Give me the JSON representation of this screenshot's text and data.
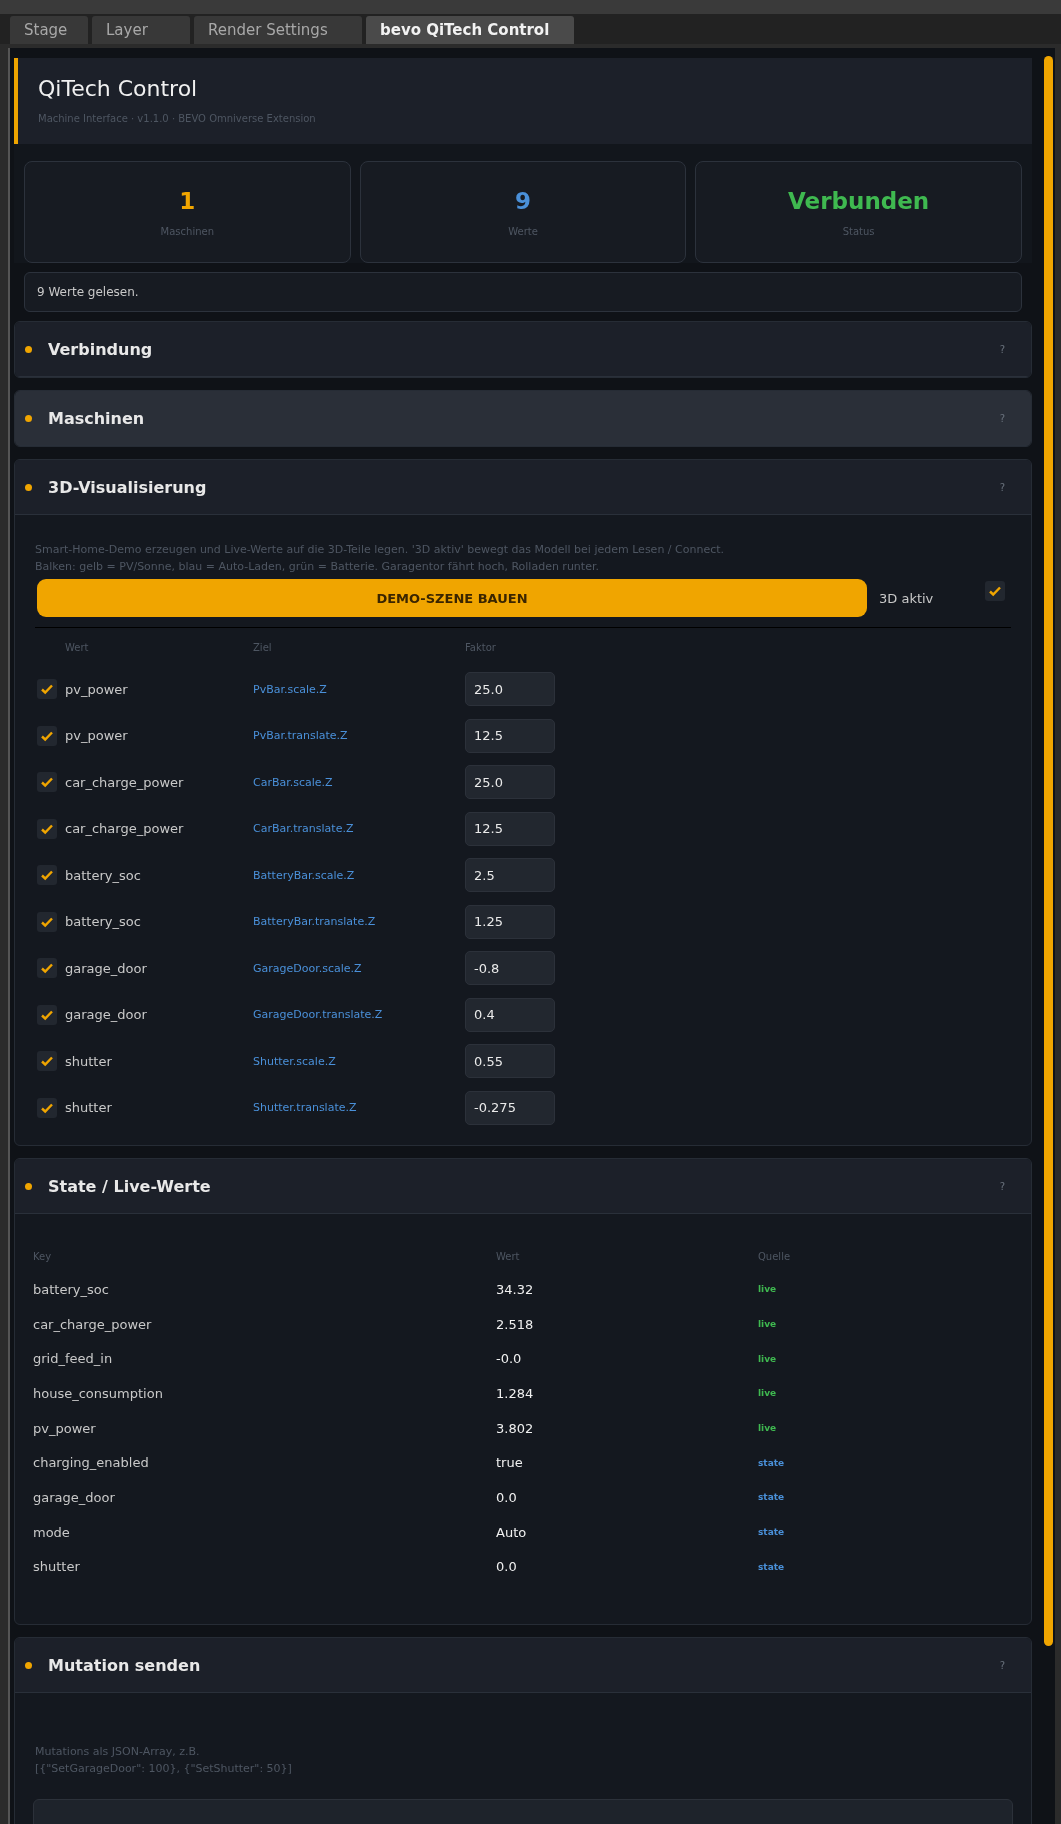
{
  "tabs": [
    {
      "label": "Stage",
      "selected": false
    },
    {
      "label": "Layer",
      "selected": false
    },
    {
      "label": "Render Settings",
      "selected": false
    },
    {
      "label": "bevo QiTech Control",
      "selected": true
    }
  ],
  "header": {
    "title": "QiTech Control",
    "subtitle": "Machine Interface  ·  v1.1.0  ·  BEVO Omniverse Extension"
  },
  "stats": [
    {
      "value": "1",
      "label": "Maschinen",
      "color": "#f0a500"
    },
    {
      "value": "9",
      "label": "Werte",
      "color": "#4a90d9"
    },
    {
      "value": "Verbunden",
      "label": "Status",
      "color": "#3fb950"
    }
  ],
  "status_message": "9 Werte gelesen.",
  "sections": [
    {
      "title": "Verbindung",
      "help": "?",
      "expanded": false,
      "highlighted": false
    },
    {
      "title": "Maschinen",
      "help": "?",
      "expanded": false,
      "highlighted": true
    },
    {
      "kind": "visualization",
      "title": "3D-Visualisierung",
      "help": "?",
      "expanded": true,
      "highlighted": false,
      "description": [
        "Smart-Home-Demo erzeugen und Live-Werte auf die 3D-Teile legen. '3D aktiv' bewegt das Modell bei jedem Lesen / Connect.",
        "Balken: gelb = PV/Sonne, blau = Auto-Laden, grün = Batterie. Garagentor fährt hoch, Rolladen runter."
      ],
      "button": "DEMO-SZENE BAUEN",
      "toggle": {
        "label": "3D aktiv",
        "checked": true
      },
      "columns": [
        "Wert",
        "Ziel",
        "Faktor"
      ],
      "rows": [
        {
          "checked": true,
          "value": "pv_power",
          "target": "PvBar.scale.Z",
          "factor": "25.0"
        },
        {
          "checked": true,
          "value": "pv_power",
          "target": "PvBar.translate.Z",
          "factor": "12.5"
        },
        {
          "checked": true,
          "value": "car_charge_power",
          "target": "CarBar.scale.Z",
          "factor": "25.0"
        },
        {
          "checked": true,
          "value": "car_charge_power",
          "target": "CarBar.translate.Z",
          "factor": "12.5"
        },
        {
          "checked": true,
          "value": "battery_soc",
          "target": "BatteryBar.scale.Z",
          "factor": "2.5"
        },
        {
          "checked": true,
          "value": "battery_soc",
          "target": "BatteryBar.translate.Z",
          "factor": "1.25"
        },
        {
          "checked": true,
          "value": "garage_door",
          "target": "GarageDoor.scale.Z",
          "factor": "-0.8"
        },
        {
          "checked": true,
          "value": "garage_door",
          "target": "GarageDoor.translate.Z",
          "factor": "0.4"
        },
        {
          "checked": true,
          "value": "shutter",
          "target": "Shutter.scale.Z",
          "factor": "0.55"
        },
        {
          "checked": true,
          "value": "shutter",
          "target": "Shutter.translate.Z",
          "factor": "-0.275"
        }
      ]
    },
    {
      "kind": "state",
      "title": "State / Live-Werte",
      "help": "?",
      "expanded": true,
      "highlighted": false,
      "columns": [
        "Key",
        "Wert",
        "Quelle"
      ],
      "rows": [
        {
          "key": "battery_soc",
          "value": "34.32",
          "source": "live",
          "color": "#3fb950"
        },
        {
          "key": "car_charge_power",
          "value": "2.518",
          "source": "live",
          "color": "#3fb950"
        },
        {
          "key": "grid_feed_in",
          "value": "-0.0",
          "source": "live",
          "color": "#3fb950"
        },
        {
          "key": "house_consumption",
          "value": "1.284",
          "source": "live",
          "color": "#3fb950"
        },
        {
          "key": "pv_power",
          "value": "3.802",
          "source": "live",
          "color": "#3fb950"
        },
        {
          "key": "charging_enabled",
          "value": "true",
          "source": "state",
          "color": "#4a90d9"
        },
        {
          "key": "garage_door",
          "value": "0.0",
          "source": "state",
          "color": "#4a90d9"
        },
        {
          "key": "mode",
          "value": "Auto",
          "source": "state",
          "color": "#4a90d9"
        },
        {
          "key": "shutter",
          "value": "0.0",
          "source": "state",
          "color": "#4a90d9"
        }
      ]
    },
    {
      "kind": "mutation",
      "title": "Mutation senden",
      "help": "?",
      "expanded": true,
      "highlighted": false,
      "description": [
        "Mutations als JSON-Array, z.B.",
        "[{\"SetGarageDoor\": 100}, {\"SetShutter\": 50}]"
      ]
    }
  ]
}
